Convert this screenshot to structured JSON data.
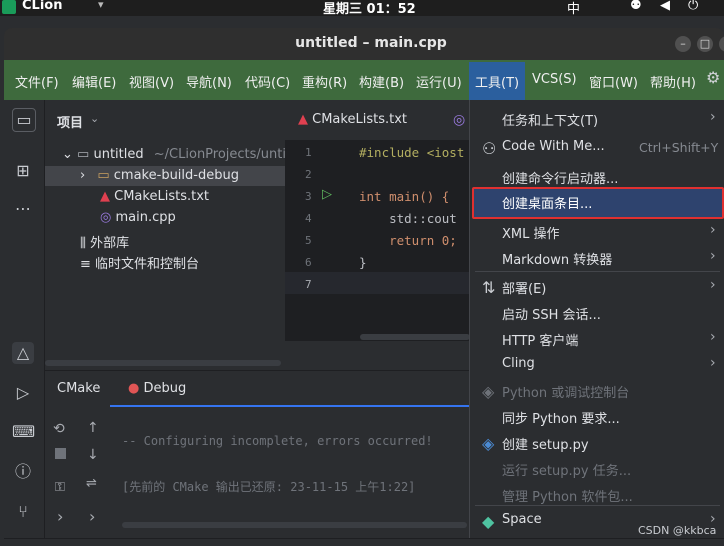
{
  "os": {
    "app_name": "CLion",
    "clock": "星期三 01：52",
    "input_method": "中"
  },
  "window": {
    "title": "untitled – main.cpp"
  },
  "menubar": [
    {
      "label": "文件(F)"
    },
    {
      "label": "编辑(E)"
    },
    {
      "label": "视图(V)"
    },
    {
      "label": "导航(N)"
    },
    {
      "label": "代码(C)"
    },
    {
      "label": "重构(R)"
    },
    {
      "label": "构建(B)"
    },
    {
      "label": "运行(U)"
    },
    {
      "label": "工具(T)"
    },
    {
      "label": "VCS(S)"
    },
    {
      "label": "窗口(W)"
    },
    {
      "label": "帮助(H)"
    }
  ],
  "project": {
    "header": "项目",
    "root": "untitled",
    "root_path": "~/CLionProjects/unti",
    "items": [
      "cmake-build-debug",
      "CMakeLists.txt",
      "main.cpp"
    ],
    "external": "外部库",
    "scratches": "临时文件和控制台"
  },
  "editor": {
    "tab": "CMakeLists.txt",
    "line_numbers": [
      "1",
      "2",
      "3",
      "4",
      "5",
      "6",
      "7"
    ],
    "code": [
      "#include <iost",
      "",
      "int main() {",
      "    std::cout",
      "    return 0;",
      "}",
      ""
    ]
  },
  "bottom": {
    "tabs": [
      "CMake",
      "Debug"
    ],
    "lines": [
      "-- Configuring incomplete, errors occurred!",
      "[先前的 CMake 输出已还原: 23-11-15 上午1:22]"
    ]
  },
  "tools_menu": [
    {
      "label": "任务和上下文(T)",
      "submenu": true
    },
    {
      "label": "Code With Me...",
      "shortcut": "Ctrl+Shift+Y"
    },
    {
      "label": "创建命令行启动器..."
    },
    {
      "label": "创建桌面条目...",
      "highlighted": true
    },
    {
      "label": "XML 操作",
      "submenu": true
    },
    {
      "label": "Markdown 转换器",
      "submenu": true
    },
    {
      "label": "部署(E)",
      "submenu": true
    },
    {
      "label": "启动 SSH 会话..."
    },
    {
      "label": "HTTP 客户端",
      "submenu": true
    },
    {
      "label": "Cling",
      "submenu": true
    },
    {
      "label": "Python 或调试控制台",
      "disabled": true
    },
    {
      "label": "同步 Python 要求..."
    },
    {
      "label": "创建 setup.py"
    },
    {
      "label": "运行 setup.py 任务...",
      "disabled": true
    },
    {
      "label": "管理 Python 软件包...",
      "disabled": true
    },
    {
      "label": "Space",
      "submenu": true
    }
  ],
  "watermark": "CSDN @kkbca",
  "colors": {
    "highlight_border": "#e03030",
    "menubar_bg": "#3e6a3d"
  }
}
